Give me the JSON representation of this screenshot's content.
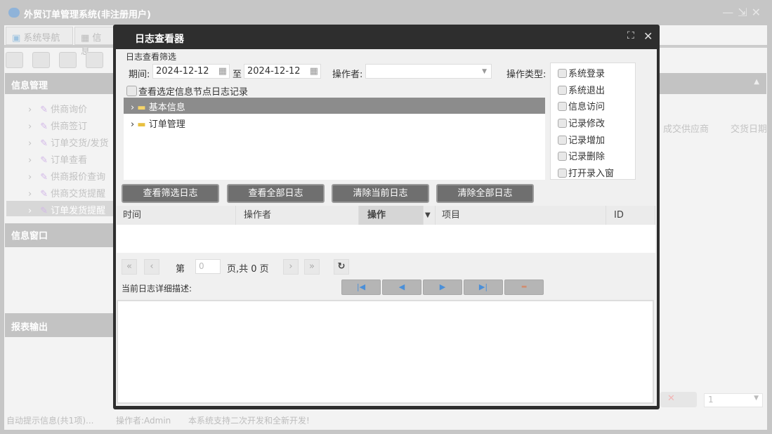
{
  "app": {
    "title": "外贸订单管理系统(非注册用户)",
    "window_controls": [
      "minimize",
      "restore",
      "close"
    ]
  },
  "tabs": [
    {
      "label": "系统导航"
    },
    {
      "label": "信息"
    }
  ],
  "sidebar": {
    "section1": "信息管理",
    "items": [
      {
        "label": "供商询价"
      },
      {
        "label": "供商签订"
      },
      {
        "label": "订单交货/发货"
      },
      {
        "label": "订单查看"
      },
      {
        "label": "供商报价查询"
      },
      {
        "label": "供商交货提醒"
      },
      {
        "label": "订单发货提醒",
        "selected": true
      }
    ],
    "section2": "信息窗口",
    "section3": "报表输出"
  },
  "main": {
    "columns": [
      "成交供应商",
      "交货日期"
    ],
    "page_select": "1"
  },
  "status": {
    "info": "自动提示信息(共1项)...",
    "operator": "操作者:Admin",
    "note": "本系统支持二次开发和全新开发!"
  },
  "dialog": {
    "title": "日志查看器",
    "filter_title": "日志查看筛选",
    "period_label": "期间:",
    "date_from": "2024-12-12",
    "to_label": "至",
    "date_to": "2024-12-12",
    "operator_label": "操作者:",
    "operator_value": "",
    "optype_label": "操作类型:",
    "optypes": [
      "系统登录",
      "系统退出",
      "信息访问",
      "记录修改",
      "记录增加",
      "记录删除",
      "打开录入窗"
    ],
    "node_check_label": "查看选定信息节点日志记录",
    "tree": [
      {
        "label": "基本信息",
        "selected": true
      },
      {
        "label": "订单管理"
      }
    ],
    "buttons": [
      "查看筛选日志",
      "查看全部日志",
      "清除当前日志",
      "清除全部日志"
    ],
    "grid_columns": [
      "时间",
      "操作者",
      "操作",
      "项目",
      "ID"
    ],
    "pager": {
      "page_prefix": "第",
      "page_value": "0",
      "page_suffix": "页,共 0 页"
    },
    "detail_label": "当前日志详细描述:",
    "detail_text": ""
  }
}
